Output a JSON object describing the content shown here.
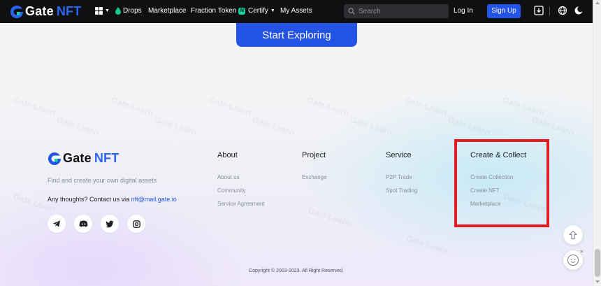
{
  "nav": {
    "logo_primary": "Gate",
    "logo_secondary": "NFT",
    "drops": "Drops",
    "marketplace": "Marketplace",
    "fraction_token": "Fraction Token",
    "fraction_badge": "N",
    "certify": "Certify",
    "my_assets": "My Assets",
    "search_placeholder": "Search",
    "login": "Log In",
    "signup": "Sign Up",
    "icons": [
      "grid-menu-icon",
      "drops-icon",
      "search-icon",
      "download-icon",
      "globe-icon",
      "theme-toggle-icon"
    ]
  },
  "hero": {
    "start_button": "Start Exploring"
  },
  "watermark_text": "Gate Learn",
  "footer": {
    "logo_primary": "Gate",
    "logo_secondary": "NFT",
    "tagline": "Find and create your own digital assets",
    "contact_prefix": "Any thoughts? Contact us via",
    "contact_email": "nft@mail.gate.io",
    "social_icons": [
      "telegram-icon",
      "discord-icon",
      "twitter-icon",
      "instagram-icon"
    ],
    "columns": [
      {
        "title": "About",
        "links": [
          "About us",
          "Community",
          "Service Agreement"
        ]
      },
      {
        "title": "Project",
        "links": [
          "Exchange"
        ]
      },
      {
        "title": "Service",
        "links": [
          "P2P Trade",
          "Spot Trading"
        ]
      },
      {
        "title": "Create & Collect",
        "links": [
          "Create Collection",
          "Create NFT",
          "Marketplace"
        ]
      }
    ],
    "copyright": "Copyright © 2003-2023. All Right Reserved."
  },
  "colors": {
    "accent": "#2354e6",
    "nav_bg": "#0f1012",
    "highlight": "#e31b23",
    "badge": "#0bd39b"
  }
}
